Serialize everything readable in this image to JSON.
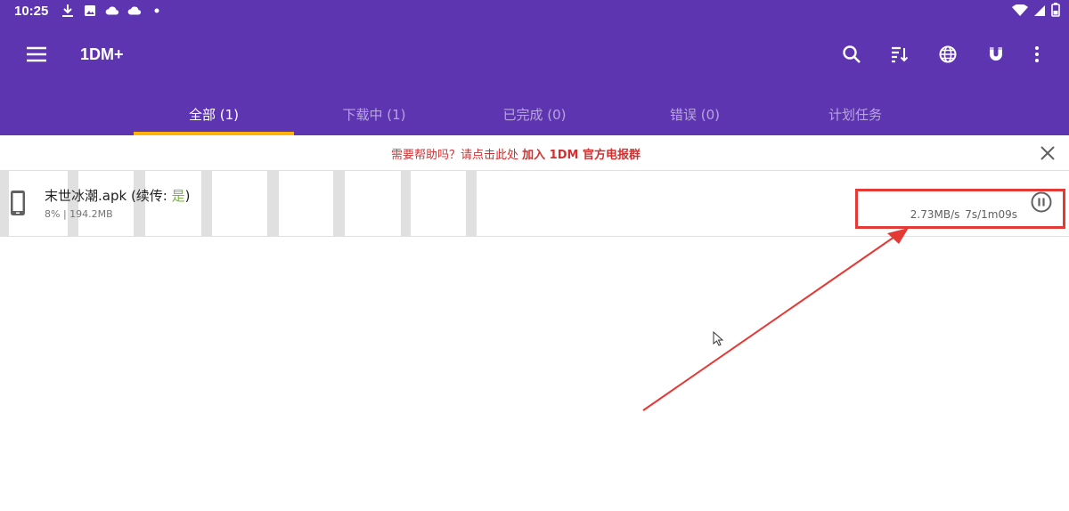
{
  "status_bar": {
    "time": "10:25",
    "icons": [
      "download-icon",
      "image-icon",
      "cloud-icon",
      "cloud-icon",
      "dot-icon"
    ],
    "right_icons": [
      "wifi-icon",
      "signal-icon",
      "battery-icon"
    ]
  },
  "app_bar": {
    "title": "1DM+",
    "background": "#5e35b1",
    "actions": [
      "search-icon",
      "sort-icon",
      "globe-icon",
      "magnet-icon",
      "more-vert-icon"
    ]
  },
  "tabs": [
    {
      "label": "全部 (1)",
      "active": true
    },
    {
      "label": "下载中 (1)",
      "active": false
    },
    {
      "label": "已完成 (0)",
      "active": false
    },
    {
      "label": "错误 (0)",
      "active": false
    },
    {
      "label": "计划任务",
      "active": false
    }
  ],
  "tab_indicator_color": "#ffb300",
  "banner": {
    "text": "需要帮助吗？请点击此处",
    "link": "加入 1DM 官方电报群",
    "color": "#d32f2f"
  },
  "download": {
    "file_name": "末世冰潮.apk",
    "resume_prefix": "(续传: ",
    "resume_value": "是",
    "resume_suffix": ")",
    "meta": "8% | 194.2MB",
    "progress_percent": 8,
    "speed_eta": "2.73MB/s  7s/1m09s"
  },
  "annotation_color": "#e53935"
}
